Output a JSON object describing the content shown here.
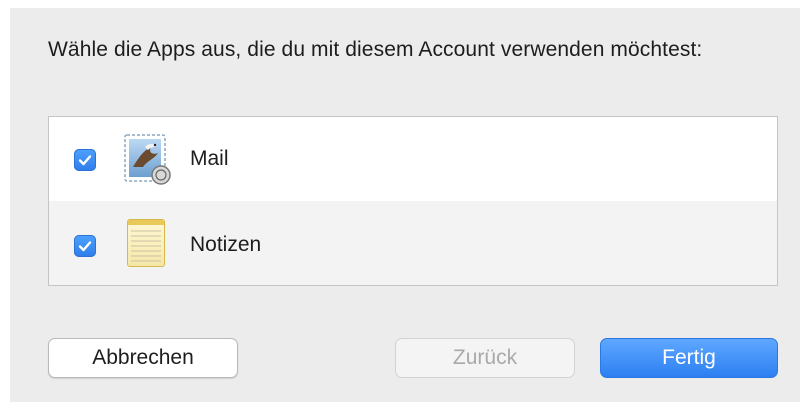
{
  "dialog": {
    "prompt": "Wähle die Apps aus, die du mit diesem Account verwenden möchtest:"
  },
  "apps": [
    {
      "name": "Mail",
      "checked": true,
      "icon": "mail-app-icon"
    },
    {
      "name": "Notizen",
      "checked": true,
      "icon": "notes-app-icon"
    }
  ],
  "buttons": {
    "cancel_label": "Abbrechen",
    "back_label": "Zurück",
    "done_label": "Fertig"
  },
  "colors": {
    "accent": "#2f7de9",
    "sheet_background": "#ececec"
  }
}
